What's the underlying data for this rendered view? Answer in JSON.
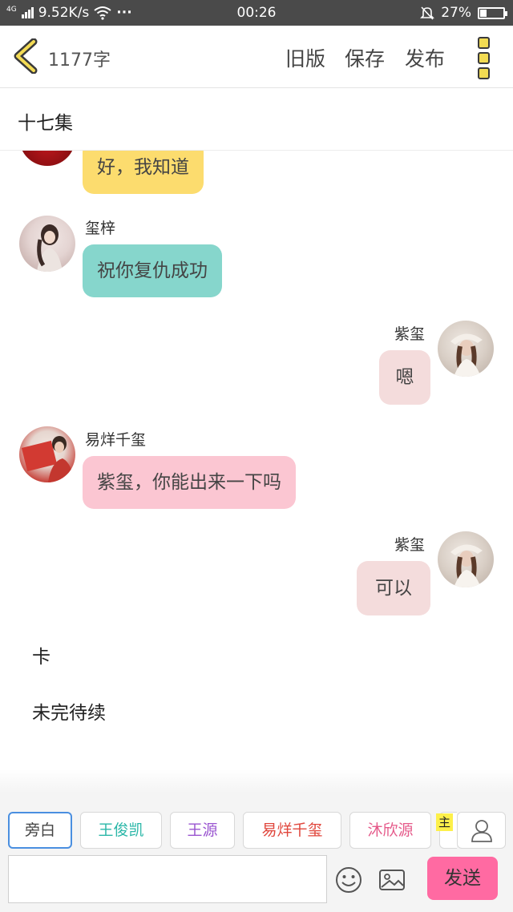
{
  "status_bar": {
    "network": "4G",
    "speed": "9.52K/s",
    "more": "···",
    "time": "00:26",
    "battery": "27%",
    "battery_level": 0.27
  },
  "top_bar": {
    "word_count": "1177字",
    "old_version": "旧版",
    "save": "保存",
    "publish": "发布"
  },
  "title": "十七集",
  "messages": [
    {
      "side": "left",
      "name": "",
      "text": "好，我知道",
      "bubble_color": "#fcdc6e"
    },
    {
      "side": "left",
      "name": "玺梓",
      "text": "祝你复仇成功",
      "bubble_color": "#86d6cc"
    },
    {
      "side": "right",
      "name": "紫玺",
      "text": "嗯",
      "bubble_color": "#f4dcdc"
    },
    {
      "side": "left",
      "name": "易烊千玺",
      "text": "紫玺，你能出来一下吗",
      "bubble_color": "#fbc6d2"
    },
    {
      "side": "right",
      "name": "紫玺",
      "text": "可以",
      "bubble_color": "#f4dcdc"
    }
  ],
  "narration": [
    "卡",
    "未完待续"
  ],
  "characters": [
    {
      "label": "旁白",
      "color": "#444444"
    },
    {
      "label": "王俊凯",
      "color": "#2bb7a8"
    },
    {
      "label": "王源",
      "color": "#9a55d0"
    },
    {
      "label": "易烊千玺",
      "color": "#e0463c"
    },
    {
      "label": "沐欣源",
      "color": "#e55a8a"
    }
  ],
  "protagonist_tag": "主",
  "input": {
    "placeholder": ""
  },
  "send_label": "发送",
  "icons": [
    "back-icon",
    "menu-icon",
    "emoji-icon",
    "image-icon",
    "user-icon",
    "wifi-icon",
    "mute-icon",
    "battery-icon"
  ]
}
